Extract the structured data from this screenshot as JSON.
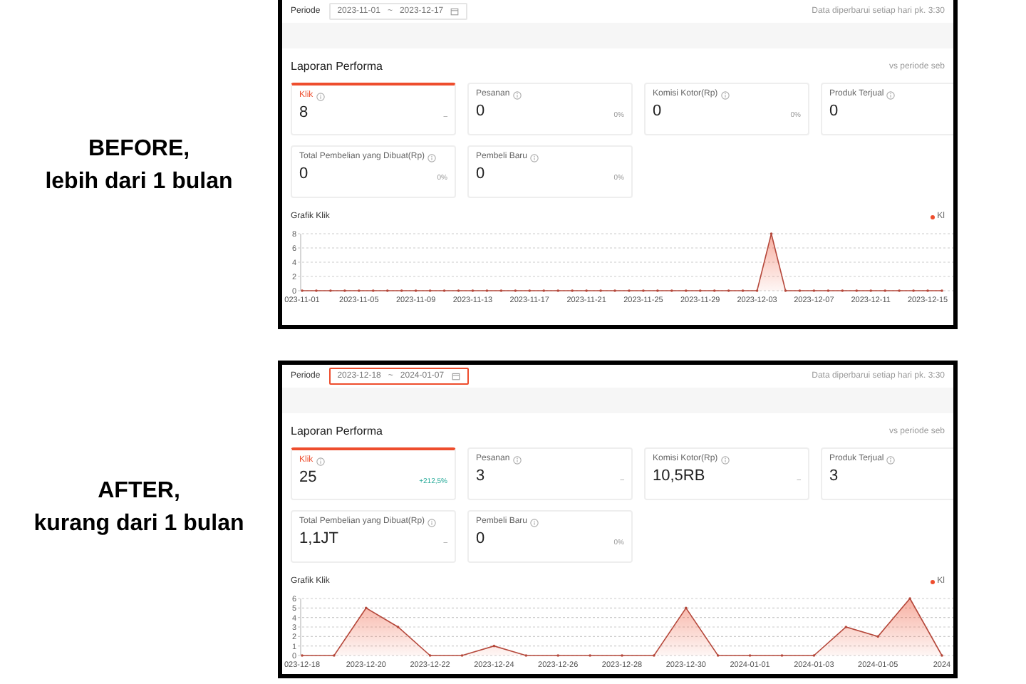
{
  "panels": [
    {
      "caption": [
        "BEFORE,",
        "lebih dari 1 bulan"
      ],
      "period_label": "Periode",
      "date_start": "2023-11-01",
      "date_sep": "~",
      "date_end": "2023-12-17",
      "date_focused": false,
      "update_note": "Data diperbarui setiap hari pk. 3:30",
      "section_title": "Laporan Performa",
      "compare_label": "vs periode seb",
      "metrics": [
        {
          "label": "Klik",
          "value": "8",
          "change": "–",
          "kind": "flat",
          "selected": true
        },
        {
          "label": "Pesanan",
          "value": "0",
          "change": "0%",
          "kind": "flat",
          "selected": false
        },
        {
          "label": "Komisi Kotor(Rp)",
          "value": "0",
          "change": "0%",
          "kind": "flat",
          "selected": false
        },
        {
          "label": "Produk Terjual",
          "value": "0",
          "kind": "flat",
          "selected": false
        },
        {
          "label": "Total Pembelian yang Dibuat(Rp)",
          "value": "0",
          "change": "0%",
          "kind": "flat",
          "selected": false
        },
        {
          "label": "Pembeli Baru",
          "value": "0",
          "change": "0%",
          "kind": "flat",
          "selected": false
        }
      ],
      "chart_title": "Grafik Klik",
      "chart_data": {
        "type": "area",
        "grid": true,
        "categories": [
          "023-11-01",
          null,
          null,
          null,
          "2023-11-05",
          null,
          null,
          null,
          "2023-11-09",
          null,
          null,
          null,
          "2023-11-13",
          null,
          null,
          null,
          "2023-11-17",
          null,
          null,
          null,
          "2023-11-21",
          null,
          null,
          null,
          "2023-11-25",
          null,
          null,
          null,
          "2023-11-29",
          null,
          null,
          null,
          "2023-12-03",
          null,
          null,
          null,
          "2023-12-07",
          null,
          null,
          null,
          "2023-12-11",
          null,
          null,
          null,
          "2023-12-15",
          null
        ],
        "series": [
          {
            "name": "Kl",
            "color": "#ee4d2d",
            "values": [
              0,
              0,
              0,
              0,
              0,
              0,
              0,
              0,
              0,
              0,
              0,
              0,
              0,
              0,
              0,
              0,
              0,
              0,
              0,
              0,
              0,
              0,
              0,
              0,
              0,
              0,
              0,
              0,
              0,
              0,
              0,
              0,
              0,
              8,
              0,
              0,
              0,
              0,
              0,
              0,
              0,
              0,
              0,
              0,
              0,
              0
            ]
          }
        ],
        "ylim": [
          0,
          8
        ],
        "yticks": [
          0,
          2,
          4,
          6,
          8
        ]
      }
    },
    {
      "caption": [
        "AFTER,",
        "kurang dari 1 bulan"
      ],
      "period_label": "Periode",
      "date_start": "2023-12-18",
      "date_sep": "~",
      "date_end": "2024-01-07",
      "date_focused": true,
      "update_note": "Data diperbarui setiap hari pk. 3:30",
      "section_title": "Laporan Performa",
      "compare_label": "vs periode seb",
      "metrics": [
        {
          "label": "Klik",
          "value": "25",
          "change": "+212,5%",
          "kind": "up",
          "selected": true
        },
        {
          "label": "Pesanan",
          "value": "3",
          "change": "–",
          "kind": "flat",
          "selected": false
        },
        {
          "label": "Komisi Kotor(Rp)",
          "value": "10,5RB",
          "change": "–",
          "kind": "flat",
          "selected": false
        },
        {
          "label": "Produk Terjual",
          "value": "3",
          "kind": "flat",
          "selected": false
        },
        {
          "label": "Total Pembelian yang Dibuat(Rp)",
          "value": "1,1JT",
          "change": "–",
          "kind": "flat",
          "selected": false
        },
        {
          "label": "Pembeli Baru",
          "value": "0",
          "change": "0%",
          "kind": "flat",
          "selected": false
        }
      ],
      "chart_title": "Grafik Klik",
      "chart_data": {
        "type": "area",
        "grid": true,
        "categories": [
          "023-12-18",
          null,
          "2023-12-20",
          null,
          "2023-12-22",
          null,
          "2023-12-24",
          null,
          "2023-12-26",
          null,
          "2023-12-28",
          null,
          "2023-12-30",
          null,
          "2024-01-01",
          null,
          "2024-01-03",
          null,
          "2024-01-05",
          null,
          "2024"
        ],
        "series": [
          {
            "name": "Kl",
            "color": "#ee4d2d",
            "values": [
              0,
              0,
              5,
              3,
              0,
              0,
              1,
              0,
              0,
              0,
              0,
              0,
              5,
              0,
              0,
              0,
              0,
              3,
              2,
              6,
              0
            ]
          }
        ],
        "ylim": [
          0,
          6
        ],
        "yticks": [
          0,
          1,
          2,
          3,
          4,
          5,
          6
        ]
      }
    }
  ]
}
